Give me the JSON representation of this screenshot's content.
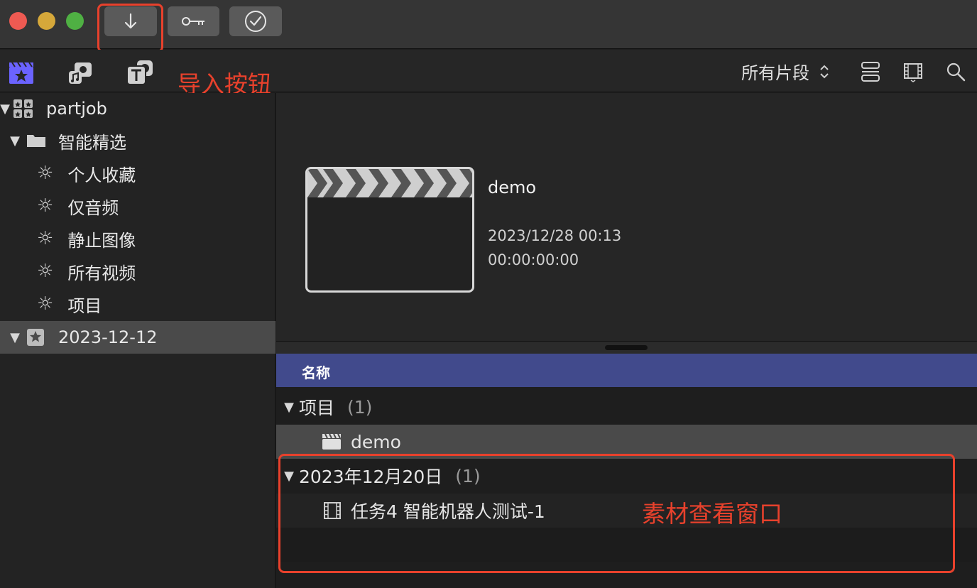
{
  "toolbar": {
    "import_tooltip": "导入按钮",
    "filter_label": "所有片段"
  },
  "sidebar": {
    "library": "partjob",
    "smart_collections_folder": "智能精选",
    "smart_collections": [
      "个人收藏",
      "仅音频",
      "静止图像",
      "所有视频",
      "项目"
    ],
    "event": "2023-12-12"
  },
  "viewer": {
    "clip_name": "demo",
    "clip_date": "2023/12/28 00:13",
    "clip_timecode": "00:00:00:00"
  },
  "list": {
    "column_name": "名称",
    "groups": [
      {
        "title": "项目",
        "count": "(1)",
        "items": [
          "demo"
        ]
      },
      {
        "title": "2023年12月20日",
        "count": "(1)",
        "items": [
          "任务4 智能机器人测试-1"
        ]
      }
    ]
  },
  "annotations": {
    "import_button": "导入按钮",
    "browser_window": "素材查看窗口"
  },
  "colors": {
    "annotation": "#e8412c",
    "list_header": "#414a8c",
    "libraries_icon": "#6b63ff"
  }
}
